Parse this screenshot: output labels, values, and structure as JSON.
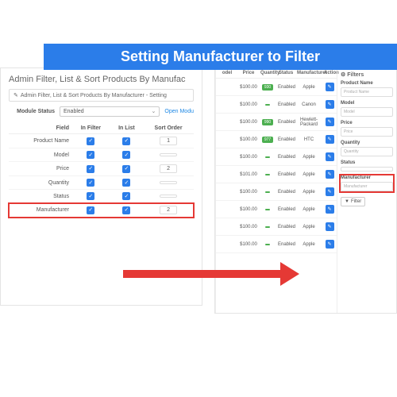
{
  "banner": "Setting Manufacturer to Filter",
  "left": {
    "title": "Admin Filter, List & Sort Products By Manufac",
    "crumb_icon": "✎",
    "crumb": "Admin Filter, List & Sort Products By Manufacturer - Setting",
    "module_status_label": "Module Status",
    "module_status_value": "Enabled",
    "open_link": "Open Modu",
    "headers": {
      "field": "Field",
      "in_filter": "In Filter",
      "in_list": "In List",
      "sort": "Sort Order"
    },
    "rows": [
      {
        "field": "Product Name",
        "order": "1"
      },
      {
        "field": "Model",
        "order": ""
      },
      {
        "field": "Price",
        "order": "2"
      },
      {
        "field": "Quantity",
        "order": ""
      },
      {
        "field": "Status",
        "order": ""
      },
      {
        "field": "Manufacturer",
        "order": "2",
        "hl": true
      }
    ]
  },
  "right": {
    "headers": {
      "model": "odel",
      "price": "Price",
      "qty": "Quantity",
      "status": "Status",
      "man": "Manufacturer",
      "act": "Action"
    },
    "rows": [
      {
        "price": "$100.00",
        "qty": "930",
        "status": "Enabled",
        "man": "Apple"
      },
      {
        "price": "$100.00",
        "qty": "",
        "status": "Enabled",
        "man": "Canon"
      },
      {
        "price": "$100.00",
        "qty": "990",
        "status": "Enabled",
        "man": "Hewlett-Packard"
      },
      {
        "price": "$100.00",
        "qty": "977",
        "status": "Enabled",
        "man": "HTC"
      },
      {
        "price": "$100.00",
        "qty": "",
        "status": "Enabled",
        "man": "Apple"
      },
      {
        "price": "$101.00",
        "qty": "",
        "status": "Enabled",
        "man": "Apple"
      },
      {
        "price": "$100.00",
        "qty": "",
        "status": "Enabled",
        "man": "Apple"
      },
      {
        "price": "$100.00",
        "qty": "",
        "status": "Enabled",
        "man": "Apple"
      },
      {
        "price": "$100.00",
        "qty": "",
        "status": "Enabled",
        "man": "Apple"
      },
      {
        "price": "$100.00",
        "qty": "",
        "status": "Enabled",
        "man": "Apple"
      }
    ],
    "filters": {
      "title": "Filters",
      "groups": [
        {
          "label": "Product Name",
          "ph": "Product Name"
        },
        {
          "label": "Model",
          "ph": "Model"
        },
        {
          "label": "Price",
          "ph": "Price"
        },
        {
          "label": "Quantity",
          "ph": "Quantity"
        },
        {
          "label": "Status",
          "ph": ""
        },
        {
          "label": "Manufacturer",
          "ph": "Manufacturer",
          "hl": true
        }
      ],
      "button": "Filter"
    }
  }
}
